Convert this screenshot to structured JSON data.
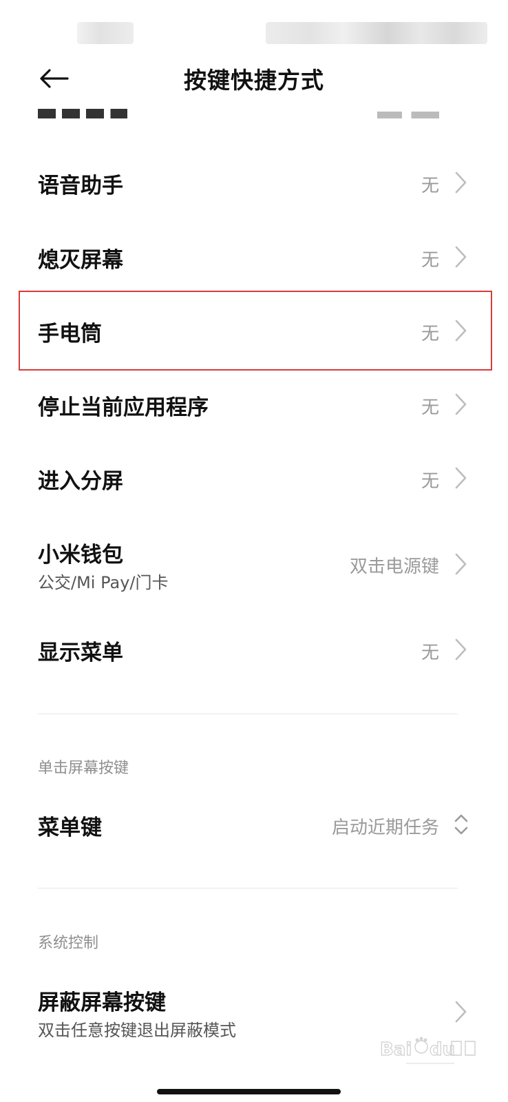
{
  "header": {
    "title": "按键快捷方式"
  },
  "rows": [
    {
      "key": "voice",
      "label": "语音助手",
      "value": "无"
    },
    {
      "key": "screen_off",
      "label": "熄灭屏幕",
      "value": "无"
    },
    {
      "key": "flashlight",
      "label": "手电筒",
      "value": "无"
    },
    {
      "key": "stop_app",
      "label": "停止当前应用程序",
      "value": "无"
    },
    {
      "key": "split",
      "label": "进入分屏",
      "value": "无"
    },
    {
      "key": "wallet",
      "label": "小米钱包",
      "sub": "公交/Mi Pay/门卡",
      "value": "双击电源键"
    },
    {
      "key": "menu",
      "label": "显示菜单",
      "value": "无"
    }
  ],
  "sections": {
    "single_tap": {
      "header": "单击屏幕按键",
      "menu_key": {
        "label": "菜单键",
        "value": "启动近期任务"
      }
    },
    "system": {
      "header": "系统控制",
      "block_keys": {
        "label": "屏蔽屏幕按键",
        "sub": "双击任意按键退出屏蔽模式"
      }
    }
  },
  "icons": {
    "back": "back-arrow-icon",
    "chevron": "chevron-right-icon",
    "updown": "chevron-up-down-icon"
  },
  "colors": {
    "highlight": "#d93a3a",
    "value_text": "#9a9a9a"
  }
}
